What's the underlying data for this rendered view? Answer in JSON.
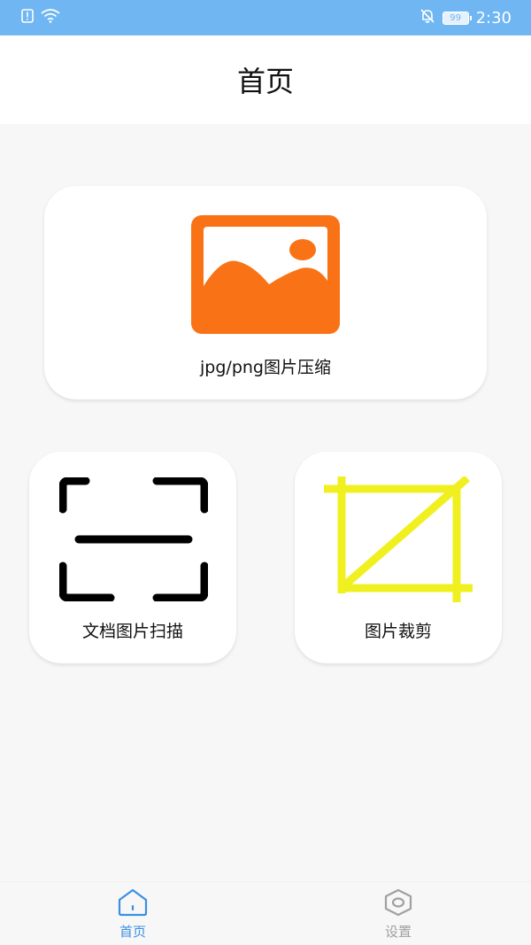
{
  "status_bar": {
    "time": "2:30",
    "battery": "99",
    "icons": [
      "alert-icon",
      "wifi-icon",
      "mute-icon",
      "battery-icon"
    ]
  },
  "header": {
    "title": "首页"
  },
  "cards": [
    {
      "label": "jpg/png图片压缩",
      "icon": "image-icon",
      "icon_color": "#f97316"
    },
    {
      "label": "文档图片扫描",
      "icon": "scan-icon",
      "icon_color": "#000000"
    },
    {
      "label": "图片裁剪",
      "icon": "crop-icon",
      "icon_color": "#f0f020"
    }
  ],
  "tabbar": {
    "tabs": [
      {
        "label": "首页",
        "icon": "home-icon",
        "active": true
      },
      {
        "label": "设置",
        "icon": "settings-icon",
        "active": false
      }
    ],
    "active_color": "#3b8fe0",
    "inactive_color": "#a0a0a0"
  },
  "colors": {
    "status_bar_bg": "#6fb6f3",
    "page_bg": "#f7f7f7"
  }
}
